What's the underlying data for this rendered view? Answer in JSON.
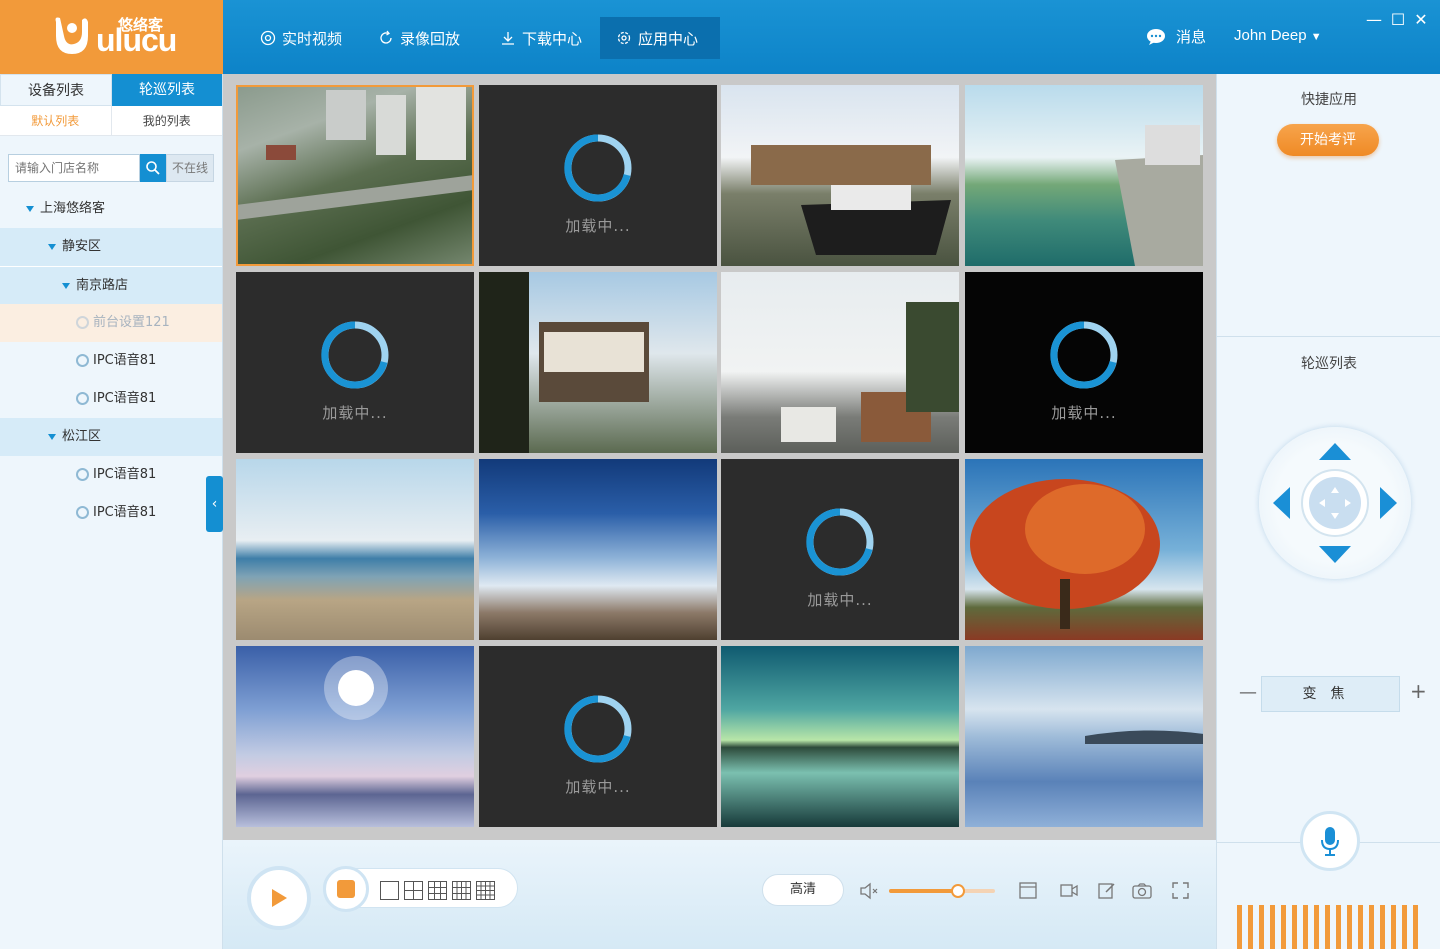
{
  "brand": {
    "name": "ulucu",
    "name_cn": "悠络客"
  },
  "nav": [
    {
      "label": "实时视频",
      "icon": "chrome-icon"
    },
    {
      "label": "录像回放",
      "icon": "refresh-icon"
    },
    {
      "label": "下载中心",
      "icon": "download-icon"
    },
    {
      "label": "应用中心",
      "icon": "gear-icon",
      "active": true
    }
  ],
  "header": {
    "messages": "消息",
    "user": "John Deep"
  },
  "sidebar": {
    "tabs": [
      "设备列表",
      "轮巡列表"
    ],
    "subtabs": [
      "默认列表",
      "我的列表"
    ],
    "search_placeholder": "请输入门店名称",
    "offline_label": "不在线",
    "tree": [
      {
        "label": "上海悠络客",
        "level": 0,
        "type": "group"
      },
      {
        "label": "静安区",
        "level": 1,
        "type": "group"
      },
      {
        "label": "南京路店",
        "level": 2,
        "type": "group"
      },
      {
        "label": "前台设置121",
        "level": 3,
        "type": "camera",
        "offline": true
      },
      {
        "label": "IPC语音81",
        "level": 3,
        "type": "camera"
      },
      {
        "label": "IPC语音81",
        "level": 3,
        "type": "camera"
      },
      {
        "label": "松江区",
        "level": 1,
        "type": "group"
      },
      {
        "label": "IPC语音81",
        "level": 3,
        "type": "camera"
      },
      {
        "label": "IPC语音81",
        "level": 3,
        "type": "camera"
      }
    ]
  },
  "grid": {
    "loading_text": "加载中...",
    "tiles": [
      "city",
      "loading",
      "boat",
      "canal",
      "loading",
      "balcony",
      "street",
      "loading-dark",
      "beach",
      "sky",
      "loading",
      "tree",
      "sun",
      "loading",
      "lake-green",
      "lake-blue"
    ]
  },
  "rightpanel": {
    "quick_apps": "快捷应用",
    "start_eval": "开始考评",
    "patrol_list": "轮巡列表",
    "zoom": "变焦"
  },
  "bottombar": {
    "quality": "高清",
    "volume_level": 0.65
  },
  "colors": {
    "primary": "#148fd2",
    "accent": "#f29a3a"
  }
}
